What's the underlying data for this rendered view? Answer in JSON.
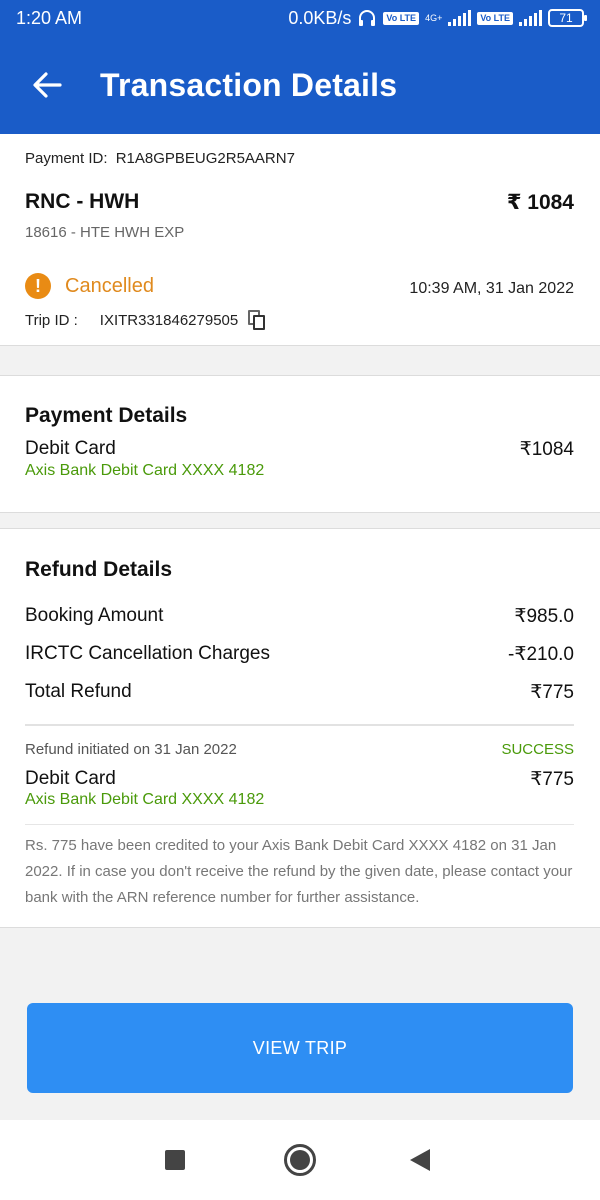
{
  "status_bar": {
    "time": "1:20 AM",
    "speed": "0.0KB/s",
    "net1": "4G+",
    "volte1": "Vo LTE",
    "volte2": "Vo LTE",
    "battery": "71"
  },
  "header": {
    "title": "Transaction Details"
  },
  "summary": {
    "payment_id_label": "Payment ID:",
    "payment_id": "R1A8GPBEUG2R5AARN7",
    "route": "RNC - HWH",
    "amount": "₹ 1084",
    "train": "18616 - HTE HWH EXP",
    "status": "Cancelled",
    "datetime": "10:39 AM, 31 Jan 2022",
    "trip_id_label": "Trip ID :",
    "trip_id": "IXITR331846279505"
  },
  "payment_details": {
    "title": "Payment Details",
    "method": "Debit Card",
    "card": "Axis Bank Debit Card XXXX 4182",
    "amount": "₹1084"
  },
  "refund_details": {
    "title": "Refund Details",
    "rows": [
      {
        "label": "Booking Amount",
        "value": "₹985.0"
      },
      {
        "label": "IRCTC Cancellation Charges",
        "value": "-₹210.0"
      },
      {
        "label": "Total Refund",
        "value": "₹775"
      }
    ],
    "initiated": "Refund initiated on 31 Jan 2022",
    "status": "SUCCESS",
    "method": "Debit Card",
    "card": "Axis Bank Debit Card XXXX 4182",
    "amount": "₹775",
    "note": "Rs. 775 have been credited to your Axis Bank Debit Card XXXX 4182 on 31 Jan 2022. If in case you don't receive the refund by the given date, please contact your bank with the ARN reference number for further assistance."
  },
  "actions": {
    "view_trip": "VIEW TRIP"
  },
  "colors": {
    "primary": "#1a5cc8",
    "button": "#2e8ef3",
    "warning": "#e08a1e",
    "success": "#4a9a0a"
  }
}
